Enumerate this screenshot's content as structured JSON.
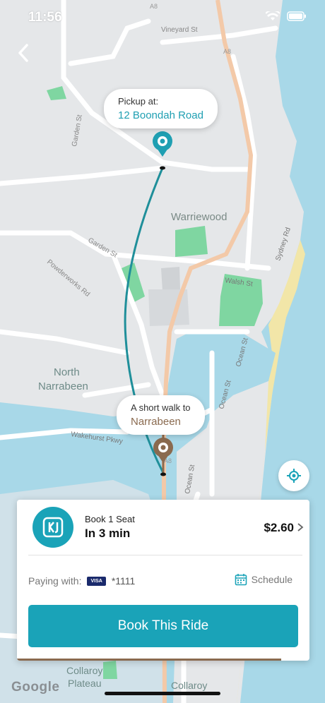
{
  "status_bar": {
    "time": "11:56"
  },
  "map": {
    "labels": {
      "warriewood": "Warriewood",
      "north": "North",
      "narrabeen": "Narrabeen",
      "collaroy_plateau_1": "Collaroy",
      "collaroy_plateau_2": "Plateau",
      "collaroy": "Collaroy",
      "vineyard": "Vineyard St",
      "garden1": "Garden St",
      "garden2": "Garden St",
      "powderworks": "Powderworks Rd",
      "walsh": "Walsh St",
      "sydney": "Sydney Rd",
      "ocean1": "Ocean St",
      "ocean2": "Ocean St",
      "ocean3": "Ocean St",
      "wakehurst": "Wakehurst Pkwy",
      "a8_1": "A8",
      "a8_2": "A8",
      "a8_3": "A8"
    },
    "pickup": {
      "label": "Pickup at:",
      "address": "12 Boondah Road"
    },
    "dropoff": {
      "label": "A short walk to",
      "place": "Narrabeen"
    },
    "attribution": "Google"
  },
  "colors": {
    "accent": "#1aa3b8",
    "route": "#1f8f9a",
    "walk": "#8a6a4f",
    "park": "#7fd6a1",
    "water": "#a8d8e8"
  },
  "ride_card": {
    "seat_text": "Book 1 Seat",
    "eta_text": "In 3 min",
    "price": "$2.60",
    "paying_label": "Paying with:",
    "card_brand": "VISA",
    "card_number": "*1111",
    "schedule_label": "Schedule",
    "book_button": "Book This Ride"
  },
  "icons": {
    "back": "back-chevron-icon",
    "locate": "locate-icon",
    "schedule": "calendar-icon",
    "wifi": "wifi-icon",
    "battery": "battery-icon"
  }
}
